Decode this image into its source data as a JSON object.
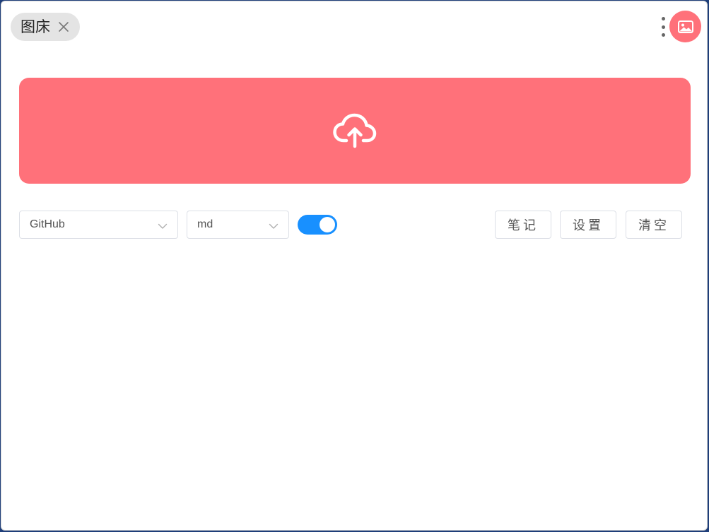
{
  "header": {
    "tab": {
      "label": "图床",
      "close_icon": "close-icon"
    },
    "more_icon": "more-vertical-icon",
    "avatar_icon": "image-icon"
  },
  "upload": {
    "icon": "cloud-upload-icon",
    "color": "#ff717a"
  },
  "toolbar": {
    "host_select": {
      "value": "GitHub",
      "icon": "chevron-down-icon"
    },
    "format_select": {
      "value": "md",
      "icon": "chevron-down-icon"
    },
    "toggle": {
      "on": true,
      "color": "#1890ff"
    },
    "buttons": {
      "notes": "笔记",
      "settings": "设置",
      "clear": "清空"
    }
  }
}
